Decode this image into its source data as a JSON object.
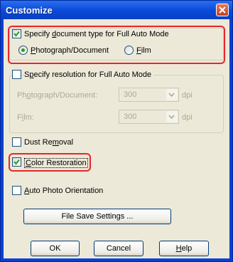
{
  "window": {
    "title": "Customize"
  },
  "doc_type_group": {
    "label_pre": "Specify ",
    "label_key": "d",
    "label_post": "ocument type for Full Auto Mode",
    "checked": true,
    "radio_photo": {
      "key": "P",
      "rest": "hotograph/Document",
      "selected": true
    },
    "radio_film": {
      "key": "F",
      "rest": "ilm",
      "selected": false
    }
  },
  "resolution_group": {
    "label_pre": "S",
    "label_key": "p",
    "label_post": "ecify resolution for Full Auto Mode",
    "checked": false,
    "photo_label_pre": "Ph",
    "photo_label_key": "o",
    "photo_label_post": "tograph/Document:",
    "photo_value": "300",
    "film_label_pre": "F",
    "film_label_key": "i",
    "film_label_post": "lm:",
    "film_value": "300",
    "unit": "dpi"
  },
  "dust_removal": {
    "label_pre": "Dust Re",
    "label_key": "m",
    "label_post": "oval",
    "checked": false
  },
  "color_restoration": {
    "label_pre": "",
    "label_key": "C",
    "label_post": "olor Restoration",
    "checked": true
  },
  "auto_orientation": {
    "label_pre": "",
    "label_key": "A",
    "label_post": "uto Photo Orientation",
    "checked": false
  },
  "buttons": {
    "file_save": "File Save Settings ...",
    "ok": "OK",
    "cancel": "Cancel",
    "help_key": "H",
    "help_rest": "elp"
  },
  "colors": {
    "highlight": "#e8262c",
    "title_bar": "#0a49d6",
    "dialog_bg": "#ece9d8"
  }
}
